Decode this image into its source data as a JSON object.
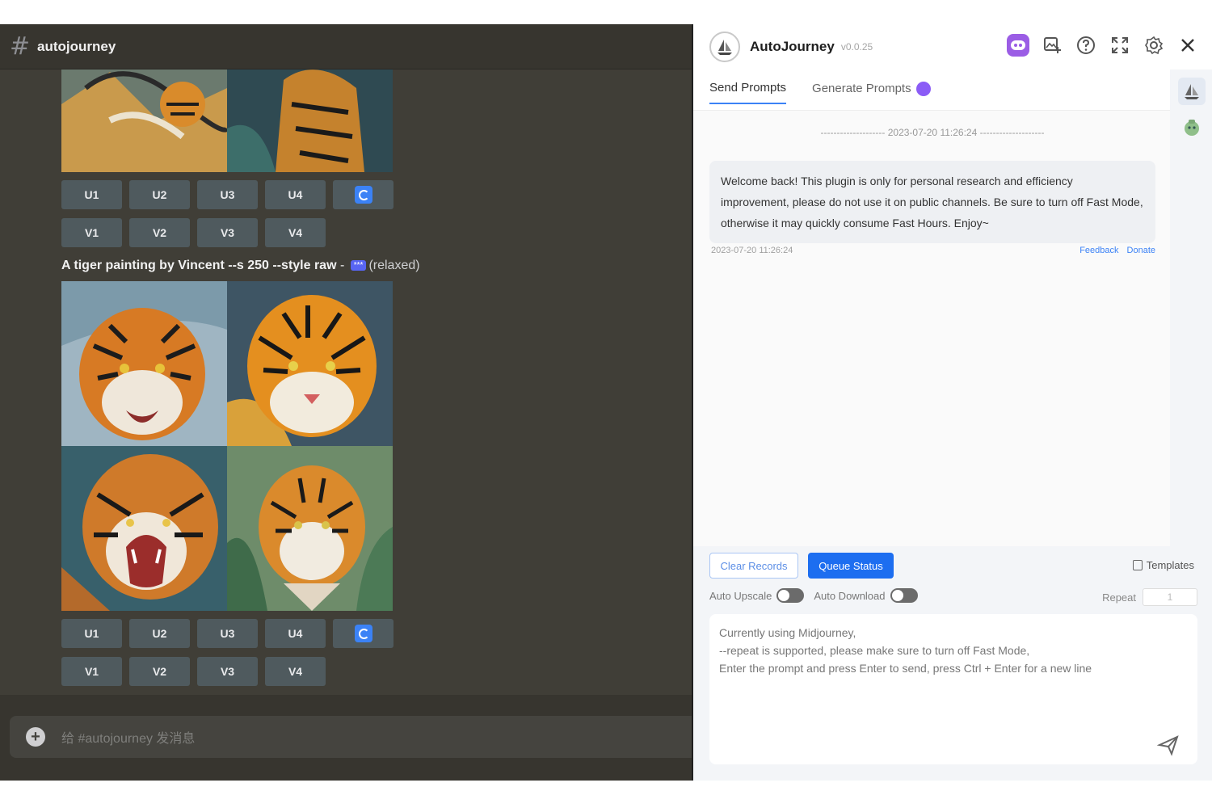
{
  "discord": {
    "channel_name": "autojourney",
    "prompt": {
      "text": "A tiger painting by Vincent --s 250 --style raw",
      "separator": " - ",
      "mention": "***",
      "status": "(relaxed)"
    },
    "upscale_buttons": [
      "U1",
      "U2",
      "U3",
      "U4"
    ],
    "variation_buttons": [
      "V1",
      "V2",
      "V3",
      "V4"
    ],
    "composer_placeholder": "给 #autojourney 发消息"
  },
  "panel": {
    "title": "AutoJourney",
    "version": "v0.0.25",
    "header_icons": [
      "discord-icon",
      "image-upload-icon",
      "help-icon",
      "expand-icon",
      "settings-icon",
      "close-icon"
    ],
    "tabs": [
      {
        "label": "Send Prompts",
        "active": true
      },
      {
        "label": "Generate Prompts",
        "active": false
      }
    ],
    "chat": {
      "separator_date": "-------------------- 2023-07-20 11:26:24 --------------------",
      "welcome_message": "Welcome back! This plugin is only for personal research and efficiency improvement, please do not use it on public channels. Be sure to turn off Fast Mode, otherwise it may quickly consume Fast Hours. Enjoy~",
      "message_time": "2023-07-20 11:26:24",
      "feedback_link": "Feedback",
      "donate_link": "Donate"
    },
    "controls": {
      "clear_records": "Clear Records",
      "queue_status": "Queue Status",
      "templates": "Templates",
      "auto_upscale": "Auto Upscale",
      "auto_download": "Auto Download",
      "repeat_label": "Repeat",
      "repeat_value": "1"
    },
    "prompt_placeholder_lines": [
      "Currently using Midjourney,",
      "--repeat is supported, please make sure to turn off Fast Mode,",
      "Enter the prompt and press Enter to send, press Ctrl + Enter for a new line"
    ]
  },
  "colors": {
    "discord_bg": "#403e37",
    "panel_accent": "#1d6ef0",
    "discord_button": "#4f5a5e"
  }
}
